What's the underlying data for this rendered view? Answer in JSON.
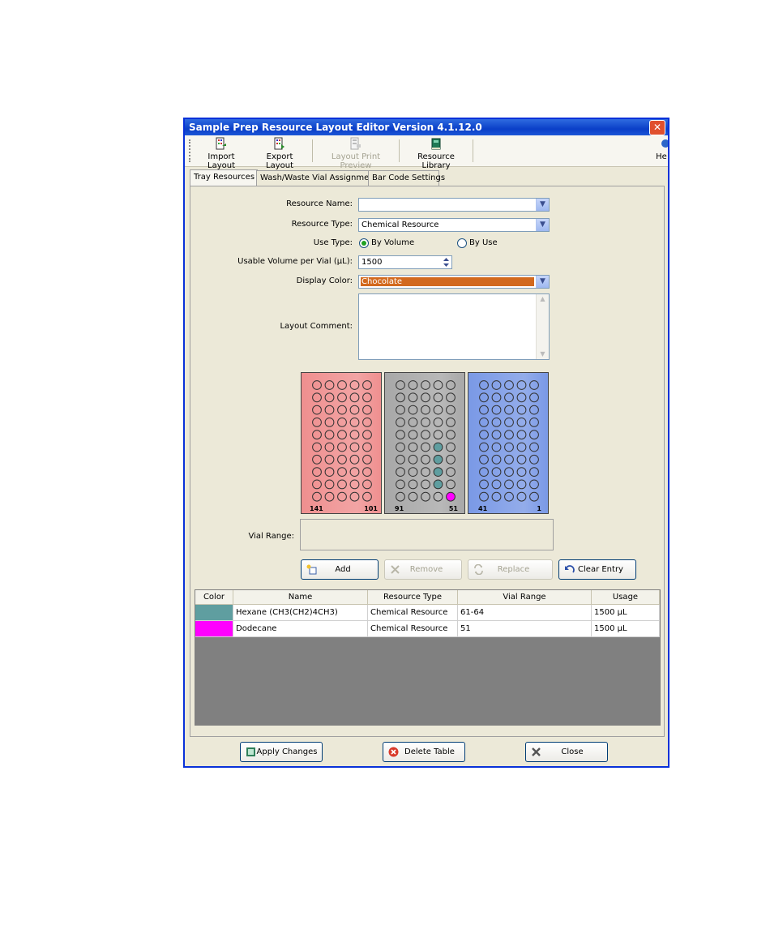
{
  "window": {
    "title": "Sample Prep Resource Layout Editor Version 4.1.12.0",
    "close_glyph": "✕"
  },
  "toolbar": {
    "import_label": "Import Layout",
    "export_label": "Export Layout",
    "print_preview_label": "Layout Print Preview",
    "library_label": "Resource Library",
    "help_label": "He"
  },
  "tabs": [
    "Tray Resources",
    "Wash/Waste Vial Assignment",
    "Bar Code Settings"
  ],
  "form": {
    "resource_name_label": "Resource Name:",
    "resource_name_value": "",
    "resource_type_label": "Resource Type:",
    "resource_type_value": "Chemical Resource",
    "use_type_label": "Use Type:",
    "use_type_options": [
      "By Volume",
      "By Use"
    ],
    "use_type_selected": "By Volume",
    "usable_volume_label": "Usable Volume per Vial (µL):",
    "usable_volume_value": "1500",
    "display_color_label": "Display Color:",
    "display_color_value": "Chocolate",
    "display_color_hex": "#d2691e",
    "layout_comment_label": "Layout Comment:",
    "layout_comment_value": ""
  },
  "trays": [
    {
      "left_number": "141",
      "right_number": "101",
      "color": "#ef8f8f"
    },
    {
      "left_number": "91",
      "right_number": "51",
      "color": "#a8a8a8"
    },
    {
      "left_number": "41",
      "right_number": "1",
      "color": "#7a99e6"
    }
  ],
  "vial_range": {
    "label": "Vial Range:",
    "value": ""
  },
  "buttons": {
    "add": "Add",
    "remove": "Remove",
    "replace": "Replace",
    "clear_entry": "Clear Entry"
  },
  "table": {
    "columns": [
      "Color",
      "Name",
      "Resource Type",
      "Vial Range",
      "Usage"
    ],
    "rows": [
      {
        "color": "#5f9ea0",
        "name": "Hexane (CH3(CH2)4CH3)",
        "resource_type": "Chemical Resource",
        "vial_range": "61-64",
        "usage": "1500 µL"
      },
      {
        "color": "#ff00ff",
        "name": "Dodecane",
        "resource_type": "Chemical Resource",
        "vial_range": "51",
        "usage": "1500 µL"
      }
    ]
  },
  "bottom_buttons": {
    "apply": "Apply Changes",
    "delete": "Delete Table",
    "close": "Close"
  },
  "highlighted_vials": [
    {
      "tray": 1,
      "row": 6,
      "col": 4,
      "color": "#5f9ea0"
    },
    {
      "tray": 1,
      "row": 7,
      "col": 4,
      "color": "#5f9ea0"
    },
    {
      "tray": 1,
      "row": 8,
      "col": 4,
      "color": "#5f9ea0"
    },
    {
      "tray": 1,
      "row": 9,
      "col": 4,
      "color": "#5f9ea0"
    },
    {
      "tray": 1,
      "row": 10,
      "col": 5,
      "color": "#ff00ff"
    }
  ]
}
